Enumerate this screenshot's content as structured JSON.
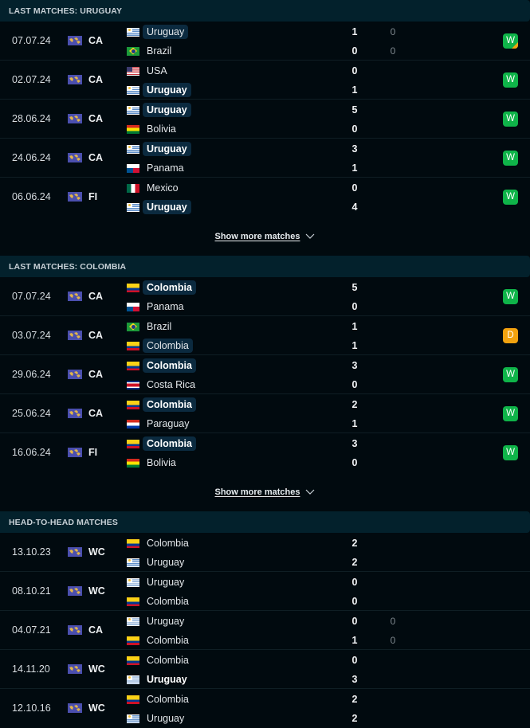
{
  "sections": [
    {
      "title": "LAST MATCHES: URUGUAY",
      "show_more": "Show more matches",
      "matches": [
        {
          "date": "07.07.24",
          "comp": "CA",
          "home": {
            "name": "Uruguay",
            "flag": "uruguay-flag",
            "highlight": true,
            "bold": false
          },
          "away": {
            "name": "Brazil",
            "flag": "brazil-flag",
            "highlight": false,
            "bold": false
          },
          "score": [
            "1",
            "0"
          ],
          "pens": [
            "0",
            "0"
          ],
          "result": "W",
          "penalty_win": true
        },
        {
          "date": "02.07.24",
          "comp": "CA",
          "home": {
            "name": "USA",
            "flag": "usa-flag",
            "highlight": false,
            "bold": false
          },
          "away": {
            "name": "Uruguay",
            "flag": "uruguay-flag",
            "highlight": true,
            "bold": true
          },
          "score": [
            "0",
            "1"
          ],
          "pens": null,
          "result": "W",
          "penalty_win": false
        },
        {
          "date": "28.06.24",
          "comp": "CA",
          "home": {
            "name": "Uruguay",
            "flag": "uruguay-flag",
            "highlight": true,
            "bold": true
          },
          "away": {
            "name": "Bolivia",
            "flag": "bolivia-flag",
            "highlight": false,
            "bold": false
          },
          "score": [
            "5",
            "0"
          ],
          "pens": null,
          "result": "W",
          "penalty_win": false
        },
        {
          "date": "24.06.24",
          "comp": "CA",
          "home": {
            "name": "Uruguay",
            "flag": "uruguay-flag",
            "highlight": true,
            "bold": true
          },
          "away": {
            "name": "Panama",
            "flag": "panama-flag",
            "highlight": false,
            "bold": false
          },
          "score": [
            "3",
            "1"
          ],
          "pens": null,
          "result": "W",
          "penalty_win": false
        },
        {
          "date": "06.06.24",
          "comp": "FI",
          "home": {
            "name": "Mexico",
            "flag": "mexico-flag",
            "highlight": false,
            "bold": false
          },
          "away": {
            "name": "Uruguay",
            "flag": "uruguay-flag",
            "highlight": true,
            "bold": true
          },
          "score": [
            "0",
            "4"
          ],
          "pens": null,
          "result": "W",
          "penalty_win": false
        }
      ]
    },
    {
      "title": "LAST MATCHES: COLOMBIA",
      "show_more": "Show more matches",
      "matches": [
        {
          "date": "07.07.24",
          "comp": "CA",
          "home": {
            "name": "Colombia",
            "flag": "colombia-flag",
            "highlight": true,
            "bold": true
          },
          "away": {
            "name": "Panama",
            "flag": "panama-flag",
            "highlight": false,
            "bold": false
          },
          "score": [
            "5",
            "0"
          ],
          "pens": null,
          "result": "W",
          "penalty_win": false
        },
        {
          "date": "03.07.24",
          "comp": "CA",
          "home": {
            "name": "Brazil",
            "flag": "brazil-flag",
            "highlight": false,
            "bold": false
          },
          "away": {
            "name": "Colombia",
            "flag": "colombia-flag",
            "highlight": true,
            "bold": false
          },
          "score": [
            "1",
            "1"
          ],
          "pens": null,
          "result": "D",
          "penalty_win": false
        },
        {
          "date": "29.06.24",
          "comp": "CA",
          "home": {
            "name": "Colombia",
            "flag": "colombia-flag",
            "highlight": true,
            "bold": true
          },
          "away": {
            "name": "Costa Rica",
            "flag": "costa-rica-flag",
            "highlight": false,
            "bold": false
          },
          "score": [
            "3",
            "0"
          ],
          "pens": null,
          "result": "W",
          "penalty_win": false
        },
        {
          "date": "25.06.24",
          "comp": "CA",
          "home": {
            "name": "Colombia",
            "flag": "colombia-flag",
            "highlight": true,
            "bold": true
          },
          "away": {
            "name": "Paraguay",
            "flag": "paraguay-flag",
            "highlight": false,
            "bold": false
          },
          "score": [
            "2",
            "1"
          ],
          "pens": null,
          "result": "W",
          "penalty_win": false
        },
        {
          "date": "16.06.24",
          "comp": "FI",
          "home": {
            "name": "Colombia",
            "flag": "colombia-flag",
            "highlight": true,
            "bold": true
          },
          "away": {
            "name": "Bolivia",
            "flag": "bolivia-flag",
            "highlight": false,
            "bold": false
          },
          "score": [
            "3",
            "0"
          ],
          "pens": null,
          "result": "W",
          "penalty_win": false
        }
      ]
    },
    {
      "title": "HEAD-TO-HEAD MATCHES",
      "show_more": null,
      "matches": [
        {
          "date": "13.10.23",
          "comp": "WC",
          "home": {
            "name": "Colombia",
            "flag": "colombia-flag",
            "highlight": false,
            "bold": false
          },
          "away": {
            "name": "Uruguay",
            "flag": "uruguay-flag",
            "highlight": false,
            "bold": false
          },
          "score": [
            "2",
            "2"
          ],
          "pens": null,
          "result": null,
          "penalty_win": false
        },
        {
          "date": "08.10.21",
          "comp": "WC",
          "home": {
            "name": "Uruguay",
            "flag": "uruguay-flag",
            "highlight": false,
            "bold": false
          },
          "away": {
            "name": "Colombia",
            "flag": "colombia-flag",
            "highlight": false,
            "bold": false
          },
          "score": [
            "0",
            "0"
          ],
          "pens": null,
          "result": null,
          "penalty_win": false
        },
        {
          "date": "04.07.21",
          "comp": "CA",
          "home": {
            "name": "Uruguay",
            "flag": "uruguay-flag",
            "highlight": false,
            "bold": false
          },
          "away": {
            "name": "Colombia",
            "flag": "colombia-flag",
            "highlight": false,
            "bold": false
          },
          "score": [
            "0",
            "1"
          ],
          "pens": [
            "0",
            "0"
          ],
          "result": null,
          "penalty_win": false
        },
        {
          "date": "14.11.20",
          "comp": "WC",
          "home": {
            "name": "Colombia",
            "flag": "colombia-flag",
            "highlight": false,
            "bold": false
          },
          "away": {
            "name": "Uruguay",
            "flag": "uruguay-flag",
            "highlight": false,
            "bold": true
          },
          "score": [
            "0",
            "3"
          ],
          "pens": null,
          "result": null,
          "penalty_win": false
        },
        {
          "date": "12.10.16",
          "comp": "WC",
          "home": {
            "name": "Colombia",
            "flag": "colombia-flag",
            "highlight": false,
            "bold": false
          },
          "away": {
            "name": "Uruguay",
            "flag": "uruguay-flag",
            "highlight": false,
            "bold": false
          },
          "score": [
            "2",
            "2"
          ],
          "pens": null,
          "result": null,
          "penalty_win": false
        }
      ]
    }
  ],
  "colors": {
    "win": "#0fb449",
    "draw": "#f2a20f",
    "header_bg": "#03212c",
    "page_bg": "#010a0f",
    "highlight_bg": "#0b2a3f"
  }
}
